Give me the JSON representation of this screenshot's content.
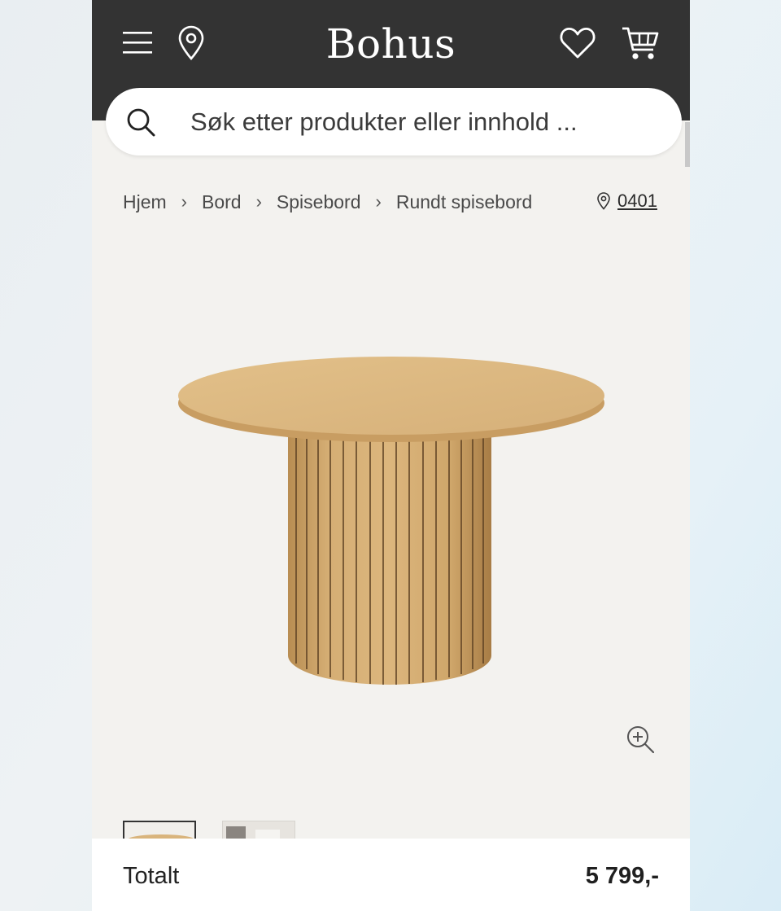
{
  "header": {
    "logo": "Bohus",
    "icons": [
      "menu-icon",
      "location-pin-icon",
      "heart-icon",
      "cart-icon"
    ],
    "background": "#333333"
  },
  "search": {
    "placeholder": "Søk etter produkter eller innhold ..."
  },
  "breadcrumb": [
    {
      "label": "Hjem"
    },
    {
      "label": "Bord"
    },
    {
      "label": "Spisebord"
    },
    {
      "label": "Rundt spisebord"
    }
  ],
  "store": {
    "code": "0401"
  },
  "product": {
    "image": "round-oak-dining-table",
    "thumbnail_count_visible": 2
  },
  "footer": {
    "total_label": "Totalt",
    "total_price": "5 799,-"
  }
}
